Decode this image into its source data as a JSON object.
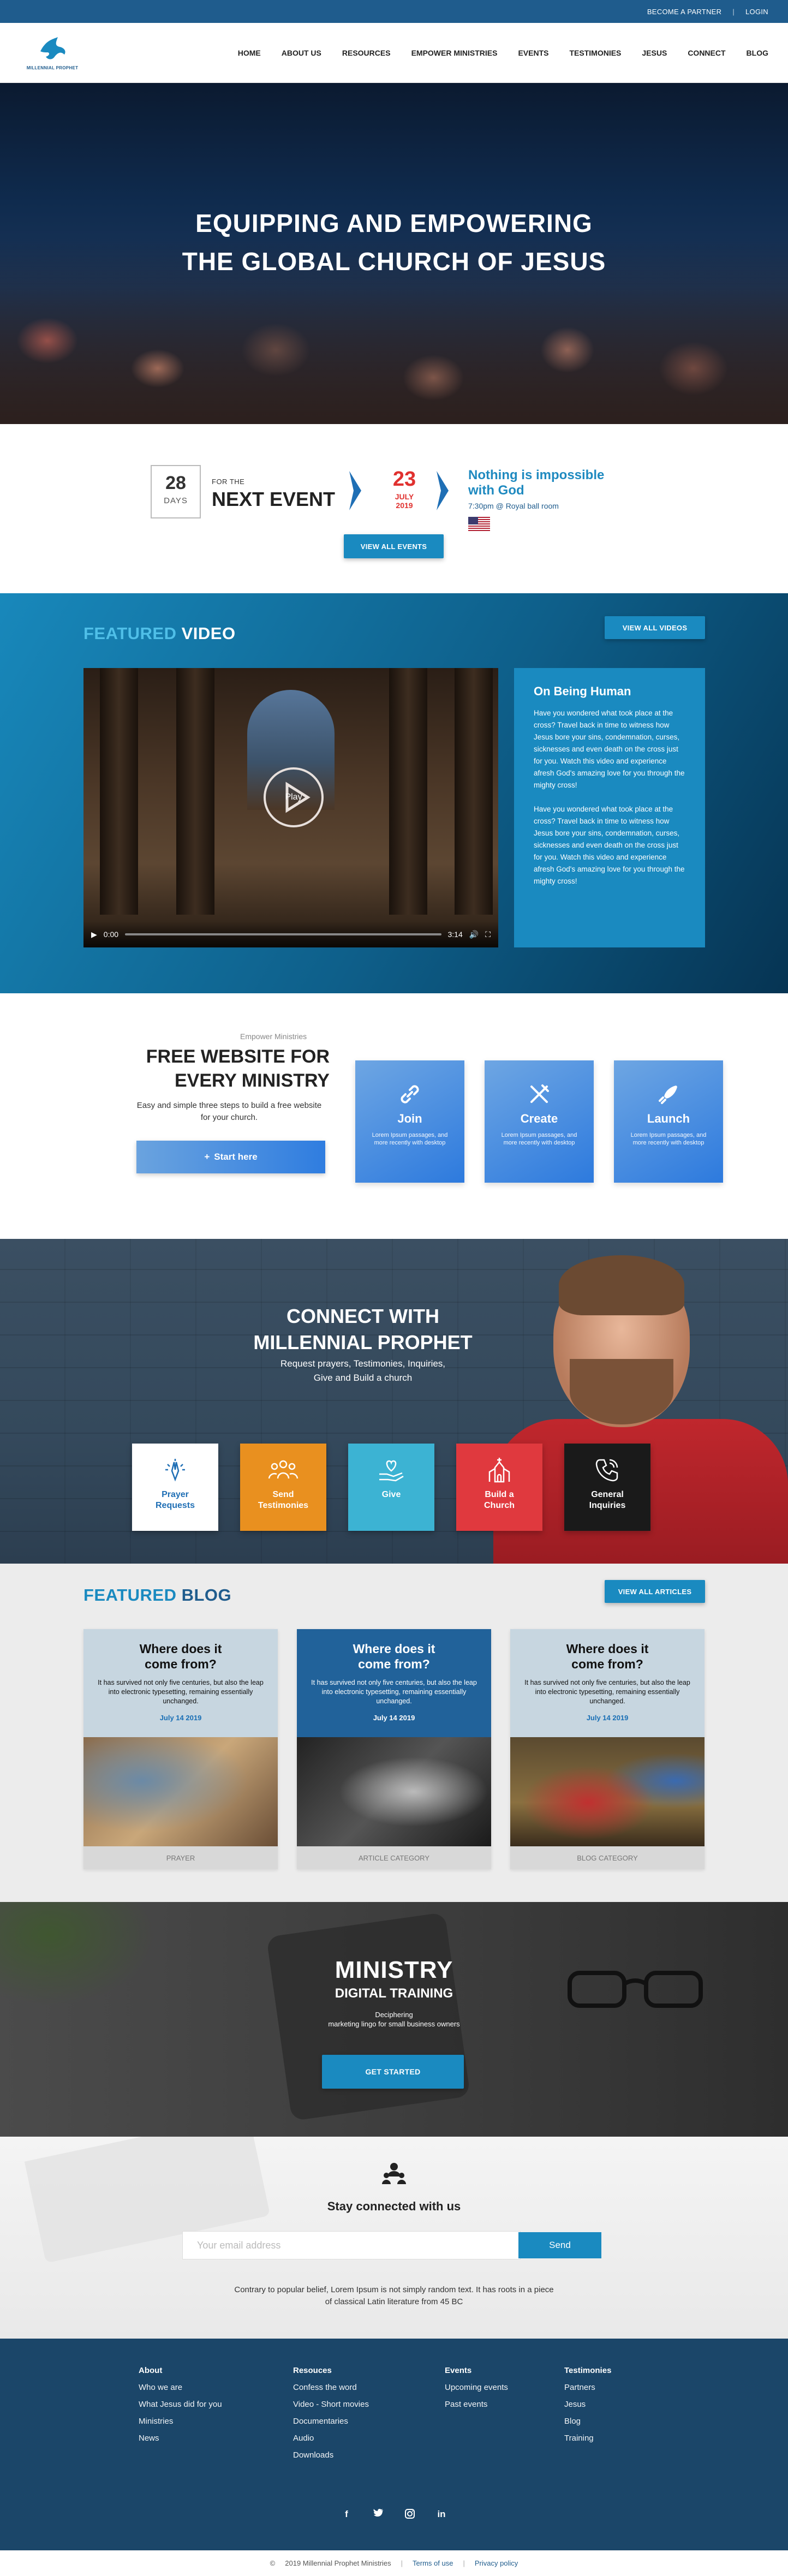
{
  "topbar": {
    "partner": "BECOME A PARTNER",
    "sep": "|",
    "login": "LOGIN"
  },
  "logo": {
    "text": "MILLENNIAL PROPHET"
  },
  "nav": [
    "HOME",
    "ABOUT US",
    "RESOURCES",
    "EMPOWER MINISTRIES",
    "EVENTS",
    "TESTIMONIES",
    "JESUS",
    "CONNECT",
    "BLOG"
  ],
  "hero": {
    "line1": "EQUIPPING AND EMPOWERING",
    "line2": "THE GLOBAL CHURCH OF JESUS"
  },
  "next_event": {
    "days_num": "28",
    "days_label": "DAYS",
    "for_the": "FOR THE",
    "title": "NEXT EVENT",
    "date_day": "23",
    "date_month": "JULY",
    "date_year": "2019",
    "event_title_1": "Nothing is impossible",
    "event_title_2": "with God",
    "event_time": "7:30pm @ Royal ball room",
    "button": "VIEW ALL EVENTS"
  },
  "featured_video": {
    "title_a": "FEATURED",
    "title_b": "VIDEO",
    "button": "VIEW ALL VIDEOS",
    "play": "Play",
    "time_current": "0:00",
    "time_total": "3:14",
    "card_title": "On Being Human",
    "para1": "Have you wondered what took place at the cross? Travel back in time to witness how Jesus bore your sins, condemnation, curses, sicknesses and even death on the cross just for you. Watch this video and experience afresh God's amazing love for you through the mighty cross!",
    "para2": "Have you wondered what took place at the cross? Travel back in time to witness how Jesus bore your sins, condemnation, curses, sicknesses and even death on the cross just for you. Watch this video and experience afresh God's amazing love for you through the mighty cross!"
  },
  "empower": {
    "small": "Empower Ministries",
    "title_1": "FREE WEBSITE FOR",
    "title_2": "EVERY MINISTRY",
    "sub": "Easy and simple three steps to build a free website  for your church.",
    "start": "Start here",
    "cards": [
      {
        "title": "Join",
        "desc": "Lorem Ipsum passages, and more recently with desktop"
      },
      {
        "title": "Create",
        "desc": "Lorem Ipsum passages, and more recently with desktop"
      },
      {
        "title": "Launch",
        "desc": "Lorem Ipsum passages, and more recently with desktop"
      }
    ]
  },
  "connect": {
    "title_1": "CONNECT WITH",
    "title_2": "MILLENNIAL PROPHET",
    "sub_1": "Request prayers, Testimonies, Inquiries,",
    "sub_2": "Give and Build a church",
    "tiles": [
      {
        "l1": "Prayer",
        "l2": "Requests",
        "bg": "#ffffff",
        "fg": "#1f6fb5"
      },
      {
        "l1": "Send",
        "l2": "Testimonies",
        "bg": "#e9901f",
        "fg": "#ffffff"
      },
      {
        "l1": "Give",
        "l2": "",
        "bg": "#3cb3d3",
        "fg": "#ffffff"
      },
      {
        "l1": "Build a",
        "l2": "Church",
        "bg": "#e0393e",
        "fg": "#ffffff"
      },
      {
        "l1": "General",
        "l2": "Inquiries",
        "bg": "#1a1a1a",
        "fg": "#ffffff"
      }
    ]
  },
  "blog": {
    "title_a": "FEATURED",
    "title_b": "BLOG",
    "button": "VIEW ALL ARTICLES",
    "cards": [
      {
        "t1": "Where does it",
        "t2": "come from?",
        "desc": "It has survived not only five centuries, but also the leap into electronic typesetting, remaining essentially unchanged.",
        "date": "July 14 2019",
        "cat": "PRAYER",
        "bg": "#c7d6e0",
        "fg": "#111",
        "dc": "#1a6fb5"
      },
      {
        "t1": "Where does it",
        "t2": "come from?",
        "desc": "It has survived not only five centuries, but also the leap into electronic typesetting, remaining essentially unchanged.",
        "date": "July 14 2019",
        "cat": "ARTICLE CATEGORY",
        "bg": "#21629a",
        "fg": "#fff",
        "dc": "#fff"
      },
      {
        "t1": "Where does it",
        "t2": "come from?",
        "desc": "It has survived not only five centuries, but also the leap into electronic typesetting, remaining essentially unchanged.",
        "date": "July 14 2019",
        "cat": "BLOG CATEGORY",
        "bg": "#c7d6e0",
        "fg": "#111",
        "dc": "#1a6fb5"
      }
    ]
  },
  "training": {
    "title": "MINISTRY",
    "sub": "DIGITAL TRAINING",
    "desc_1": "Deciphering",
    "desc_2": "marketing lingo for small business owners",
    "button": "GET STARTED"
  },
  "stay": {
    "title": "Stay connected with us",
    "placeholder": "Your email address",
    "send": "Send",
    "note_1": "Contrary to popular belief, Lorem Ipsum is not simply random text. It has roots in a piece",
    "note_2": "of classical Latin literature from 45 BC"
  },
  "footer": {
    "columns": [
      {
        "head": "About",
        "items": [
          "Who we are",
          "What Jesus did for you",
          "Ministries",
          "News"
        ]
      },
      {
        "head": "Resouces",
        "items": [
          "Confess the word",
          "Video - Short movies",
          "Documentaries",
          "Audio",
          "Downloads"
        ]
      },
      {
        "head": "Events",
        "items": [
          "Upcoming events",
          "Past events"
        ]
      },
      {
        "head": "Testimonies",
        "items": [
          "Partners",
          "Jesus",
          "Blog",
          "Training"
        ]
      }
    ],
    "social": [
      "f",
      "t",
      "o",
      "in"
    ]
  },
  "bottom": {
    "copyright": "2019 Millennial Prophet Ministries",
    "terms": "Terms of use",
    "privacy": "Privacy policy",
    "sep": "|"
  }
}
